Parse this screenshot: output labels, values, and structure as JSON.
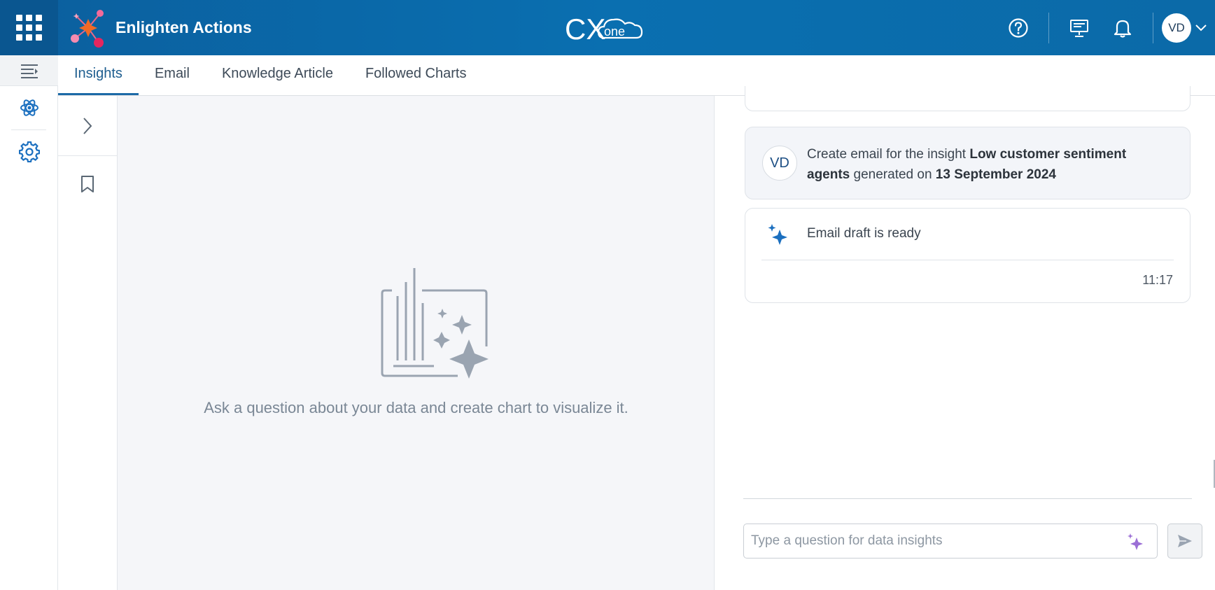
{
  "app": {
    "name": "Enlighten Actions",
    "product_logo": "CXone"
  },
  "header": {
    "icons": [
      "apps-grid-icon",
      "help-icon",
      "presentation-icon",
      "bell-icon",
      "chevron-down-icon"
    ],
    "user_initials": "VD"
  },
  "tabs": [
    {
      "label": "Insights",
      "active": true
    },
    {
      "label": "Email",
      "active": false
    },
    {
      "label": "Knowledge Article",
      "active": false
    },
    {
      "label": "Followed Charts",
      "active": false
    }
  ],
  "left_rail": {
    "icons": [
      "menu-collapse-icon",
      "atom-icon",
      "gear-icon"
    ]
  },
  "sub_rail": {
    "icons": [
      "chevron-right-icon",
      "bookmark-icon"
    ]
  },
  "canvas": {
    "empty_message": "Ask a question about your data and create chart to visualize it."
  },
  "chat": {
    "user_message": {
      "avatar": "VD",
      "prefix": "Create email for the insight ",
      "insight_name": "Low customer sentiment agents",
      "middle": " generated on ",
      "date": "13 September 2024"
    },
    "bot_message": {
      "text": "Email draft is ready",
      "time": "11:17"
    },
    "input": {
      "placeholder": "Type a question for data insights",
      "value": ""
    }
  },
  "colors": {
    "header": "#0a6fb0",
    "accent": "#1d6aa7",
    "sparkle": "#1b6fbf",
    "input_sparkle": "#9b6fd6"
  }
}
